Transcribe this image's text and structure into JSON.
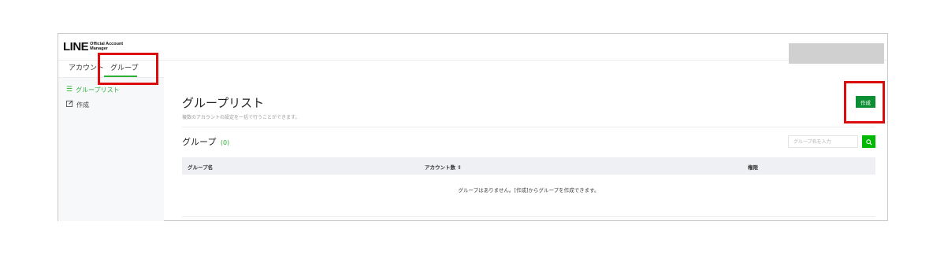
{
  "header": {
    "logo_main": "LINE",
    "logo_sub_1": "Official Account",
    "logo_sub_2": "Manager"
  },
  "tabs": [
    {
      "label": "アカウント"
    },
    {
      "label": "グループ",
      "active": true
    }
  ],
  "sidebar": {
    "items": [
      {
        "label": "グループリスト",
        "icon": "list-icon",
        "active": true
      },
      {
        "label": "作成",
        "icon": "edit-icon"
      }
    ]
  },
  "main": {
    "title": "グループリスト",
    "description": "複数のアカウントの設定を一括で行うことができます。",
    "create_label": "作成",
    "section_title": "グループ",
    "count": "(0)",
    "search": {
      "placeholder": "グループ名を入力",
      "value": ""
    },
    "table": {
      "columns": [
        "グループ名",
        "アカウント数 ⇕",
        "権限"
      ],
      "rows": [],
      "empty_message": "グループはありません。[作成]からグループを作成できます。"
    }
  },
  "colors": {
    "accent": "#2eb136",
    "create_button": "#0c8f32",
    "search_button": "#00b900",
    "annotation": "#dd0c0c"
  }
}
